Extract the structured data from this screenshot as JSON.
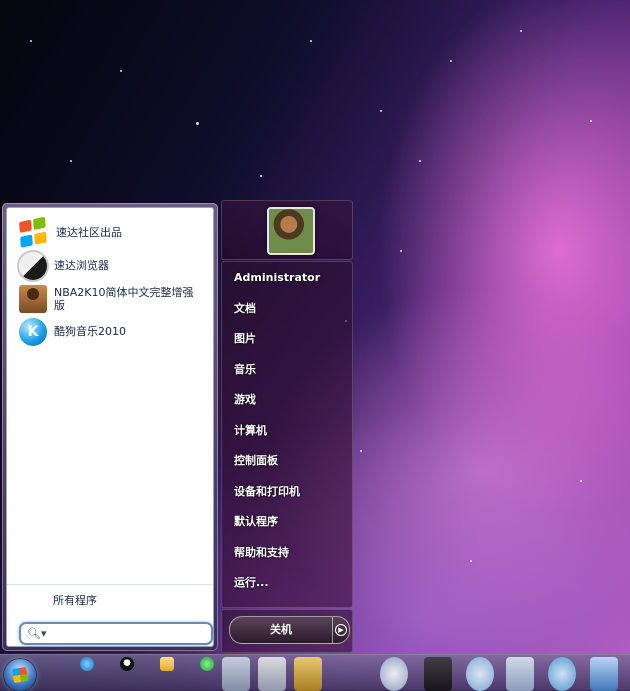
{
  "start_menu": {
    "programs": [
      {
        "label": "速达社区出品",
        "icon": "windows-flag-icon"
      },
      {
        "label": "速达浏览器",
        "icon": "yinyang-browser-icon"
      },
      {
        "label": "NBA2K10简体中文完整增强版",
        "icon": "nba-player-icon"
      },
      {
        "label": "酷狗音乐2010",
        "icon": "kugou-music-icon"
      }
    ],
    "all_programs_label": "所有程序",
    "search": {
      "placeholder": "",
      "value": ""
    },
    "right_items": [
      "Administrator",
      "文档",
      "图片",
      "音乐",
      "游戏",
      "计算机",
      "控制面板",
      "设备和打印机",
      "默认程序",
      "帮助和支持",
      "运行..."
    ],
    "shutdown_label": "关机"
  },
  "taskbar": {
    "icons": [
      "start-orb-icon",
      "internet-explorer-icon",
      "qq-penguin-icon",
      "folder-icon",
      "refresh-icon"
    ]
  },
  "colors": {
    "accent": "#6a8bb5",
    "menu_text": "#1b2a48"
  }
}
